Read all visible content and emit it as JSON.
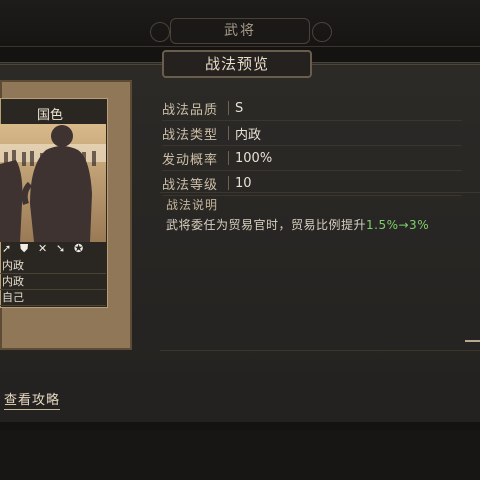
{
  "window": {
    "title": "武将"
  },
  "panel": {
    "title": "战法预览"
  },
  "card": {
    "label": "国色",
    "rows": [
      "内政",
      "内政",
      "自己"
    ]
  },
  "details": [
    {
      "label": "战法品质",
      "value": "S"
    },
    {
      "label": "战法类型",
      "value": "内政"
    },
    {
      "label": "发动概率",
      "value": "100%"
    },
    {
      "label": "战法等级",
      "value": "10"
    }
  ],
  "description": {
    "title": "战法说明",
    "text": "武将委任为贸易官时，贸易比例提升",
    "highlight": "1.5%→3%"
  },
  "footer": {
    "link": "查看攻略"
  },
  "colors": {
    "highlight": "#7fcf6a",
    "frame": "#8f7758"
  }
}
